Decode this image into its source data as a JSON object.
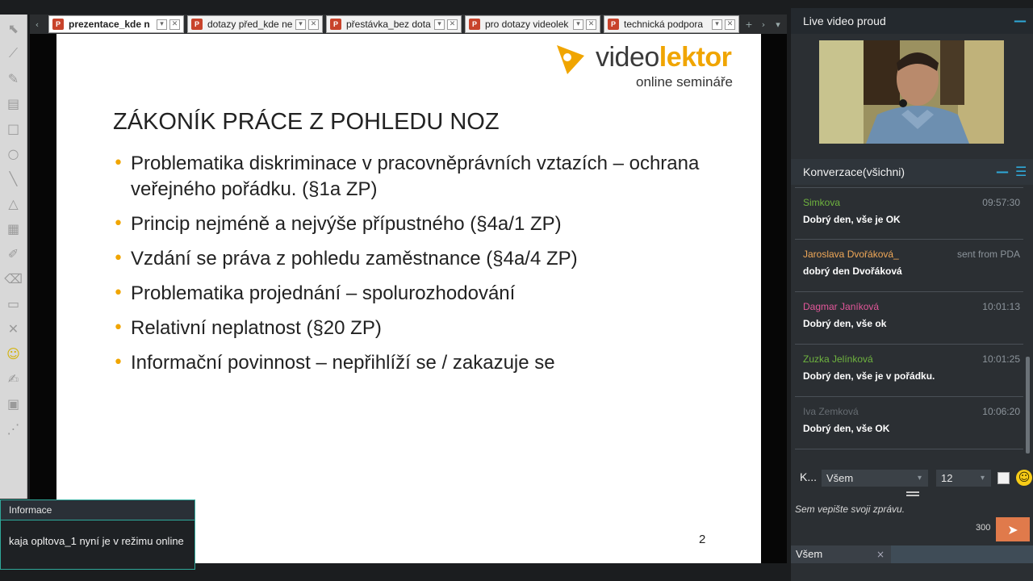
{
  "tabs": [
    {
      "label": "prezentace_kde n",
      "active": true
    },
    {
      "label": "dotazy před_kde ne",
      "active": false
    },
    {
      "label": "přestávka_bez dota",
      "active": false
    },
    {
      "label": "pro dotazy videolek",
      "active": false
    },
    {
      "label": "technická podpora",
      "active": false
    }
  ],
  "tab_icon_text": "P",
  "tab_buttons": {
    "dropdown": "▾",
    "close": "✕"
  },
  "tab_controls": {
    "add": "+",
    "prev": "‹",
    "next": "›",
    "more": "▾"
  },
  "slide": {
    "logo_word_1": "video",
    "logo_word_2": "lektor",
    "logo_sub": "online semináře",
    "title": "ZÁKONÍK PRÁCE Z POHLEDU NOZ",
    "bullets": [
      "Problematika diskriminace v pracovněprávních vztazích – ochrana veřejného pořádku. (§1a ZP)",
      "Princip nejméně a  nejvýše přípustného (§4a/1 ZP)",
      "Vzdání se práva z pohledu zaměstnance (§4a/4 ZP)",
      "Problematika projednání – spolurozhodování",
      "Relativní neplatnost (§20 ZP)",
      "Informační povinnost – nepřihlíží se / zakazuje se"
    ],
    "page_number": "2",
    "bullet_glyph": "•"
  },
  "info": {
    "title": "Informace",
    "message": "kaja opltova_1 nyní je v režimu online"
  },
  "video_panel": {
    "title": "Live video proud",
    "minimize": "—"
  },
  "conversation": {
    "title": "Konverzace(všichni)",
    "minimize": "—",
    "menu": "☰",
    "messages": [
      {
        "author": "Simkova",
        "time": "09:57:30",
        "text": "Dobrý den, vše je OK",
        "color": "#6fb43f"
      },
      {
        "author": "Jaroslava Dvořáková_",
        "time": "sent from PDA",
        "text": "dobrý den Dvořáková",
        "color": "#f0a858"
      },
      {
        "author": "Dagmar Janíková",
        "time": "10:01:13",
        "text": "Dobrý den, vše ok",
        "color": "#e2579a"
      },
      {
        "author": "Zuzka Jelínková",
        "time": "10:01:25",
        "text": "Dobrý den, vše je v pořádku.",
        "color": "#6fb43f"
      },
      {
        "author": "Iva Zemková",
        "time": "10:06:20",
        "text": "Dobrý den, vše OK",
        "color": "#666c72"
      }
    ],
    "target_label": "K...",
    "target_select": "Všem",
    "font_size_select": "12",
    "smiley": "☺",
    "compose_placeholder": "Sem vepište svoji zprávu.",
    "char_counter": "300",
    "send_icon": "➤",
    "recipient_tab": "Všem",
    "recipient_close": "×"
  },
  "tools": [
    "⬉",
    "⟋",
    "✎",
    "▤",
    "□",
    "○",
    "╲",
    "△",
    "▦",
    "✐",
    "⌫",
    "▭",
    "✕",
    "☺",
    "✍",
    "▣",
    "⋰"
  ],
  "colors": {
    "accent": "#f0a500",
    "teal": "#2fa89a",
    "panel": "#2b2f33",
    "send": "#e07a4b"
  }
}
